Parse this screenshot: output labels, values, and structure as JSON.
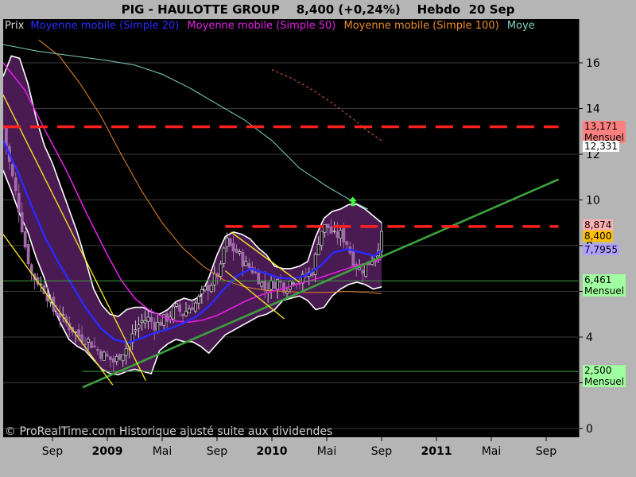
{
  "header": {
    "symbol": "PIG - HAULOTTE GROUP",
    "price": "8,400 (+0,24%)",
    "period": "Hebdo  20 Sep"
  },
  "legend": [
    {
      "label": "Prix",
      "color": "#d8d8d8"
    },
    {
      "label": "Moyenne mobile (Simple 20)",
      "color": "#2a2aff"
    },
    {
      "label": "Moyenne mobile (Simple 50)",
      "color": "#e020e0"
    },
    {
      "label": "Moyenne mobile (Simple 100)",
      "color": "#e8892a"
    },
    {
      "label": "Moye",
      "color": "#7fd0c0"
    }
  ],
  "footer": {
    "watermark": "© ProRealTime.com Historique ajusté suite aux dividendes"
  },
  "colors": {
    "background": "#000000",
    "frame": "#b5b5b5",
    "band_fill": "#4a1a52",
    "candle_up": "#c8c8c8",
    "candle_down": "#a06aa8",
    "resistance": "#ff2020",
    "support_trend": "#3ca03c",
    "channel": "#f0e020"
  },
  "chart_data": {
    "type": "candlestick",
    "title": "PIG - HAULOTTE GROUP",
    "period": "weekly",
    "ylim": [
      0,
      17.3
    ],
    "y_ticks": [
      0,
      2,
      4,
      6,
      8,
      10,
      12,
      14,
      16
    ],
    "x_ticks": [
      {
        "label": "Sep",
        "month": 0
      },
      {
        "label": "2009",
        "month": 4,
        "bold": true
      },
      {
        "label": "Mai",
        "month": 8
      },
      {
        "label": "Sep",
        "month": 12
      },
      {
        "label": "2010",
        "month": 16,
        "bold": true
      },
      {
        "label": "Mai",
        "month": 20
      },
      {
        "label": "Sep",
        "month": 24
      },
      {
        "label": "2011",
        "month": 28,
        "bold": true
      },
      {
        "label": "Mai",
        "month": 32
      },
      {
        "label": "Sep",
        "month": 36
      }
    ],
    "last_month": 24.0,
    "close_anchors": [
      [
        -3.6,
        13.2
      ],
      [
        -3.2,
        11.8
      ],
      [
        -2.5,
        9.8
      ],
      [
        -2.0,
        8.0
      ],
      [
        -1.5,
        6.7
      ],
      [
        -1.0,
        6.4
      ],
      [
        -0.5,
        6.0
      ],
      [
        0,
        5.2
      ],
      [
        0.5,
        5.0
      ],
      [
        1.0,
        4.6
      ],
      [
        1.5,
        4.3
      ],
      [
        2.0,
        4.0
      ],
      [
        2.5,
        3.9
      ],
      [
        3.0,
        3.6
      ],
      [
        3.5,
        3.3
      ],
      [
        4.0,
        3.1
      ],
      [
        4.5,
        2.9
      ],
      [
        5.0,
        3.3
      ],
      [
        5.5,
        3.6
      ],
      [
        6.0,
        4.3
      ],
      [
        6.5,
        4.7
      ],
      [
        7.0,
        4.8
      ],
      [
        7.5,
        4.5
      ],
      [
        8.0,
        4.7
      ],
      [
        8.5,
        4.9
      ],
      [
        9.0,
        5.3
      ],
      [
        9.5,
        5.0
      ],
      [
        10.0,
        5.3
      ],
      [
        10.5,
        5.5
      ],
      [
        11.0,
        6.0
      ],
      [
        11.5,
        6.3
      ],
      [
        12.0,
        6.7
      ],
      [
        12.3,
        7.0
      ],
      [
        12.6,
        8.3
      ],
      [
        13.0,
        7.9
      ],
      [
        13.5,
        7.7
      ],
      [
        14.0,
        7.2
      ],
      [
        14.5,
        7.0
      ],
      [
        15.0,
        6.6
      ],
      [
        15.5,
        6.1
      ],
      [
        16.0,
        6.3
      ],
      [
        16.5,
        6.5
      ],
      [
        17.0,
        6.1
      ],
      [
        17.5,
        6.6
      ],
      [
        18.0,
        6.4
      ],
      [
        18.5,
        6.7
      ],
      [
        19.0,
        6.9
      ],
      [
        19.5,
        8.6
      ],
      [
        20.0,
        8.9
      ],
      [
        20.5,
        8.4
      ],
      [
        21.0,
        8.5
      ],
      [
        21.5,
        8.1
      ],
      [
        22.0,
        7.2
      ],
      [
        22.5,
        6.9
      ],
      [
        23.0,
        7.2
      ],
      [
        23.5,
        7.6
      ],
      [
        24.0,
        8.4
      ]
    ],
    "sma20": [
      [
        -3.6,
        12.6
      ],
      [
        -2.5,
        11.2
      ],
      [
        -1.5,
        9.7
      ],
      [
        -0.5,
        8.3
      ],
      [
        0.5,
        7.2
      ],
      [
        1.5,
        6.2
      ],
      [
        2.5,
        5.2
      ],
      [
        3.5,
        4.4
      ],
      [
        4.5,
        3.9
      ],
      [
        5.5,
        3.75
      ],
      [
        6.5,
        3.95
      ],
      [
        7.5,
        4.2
      ],
      [
        8.5,
        4.35
      ],
      [
        9.5,
        4.6
      ],
      [
        10.5,
        4.9
      ],
      [
        11.5,
        5.4
      ],
      [
        12.5,
        6.1
      ],
      [
        13.5,
        6.7
      ],
      [
        14.5,
        7.0
      ],
      [
        15.5,
        6.8
      ],
      [
        16.5,
        6.6
      ],
      [
        17.5,
        6.55
      ],
      [
        18.5,
        6.7
      ],
      [
        19.5,
        7.1
      ],
      [
        20.5,
        7.7
      ],
      [
        21.5,
        7.85
      ],
      [
        22.5,
        7.7
      ],
      [
        23.5,
        7.55
      ],
      [
        24.0,
        7.8
      ]
    ],
    "sma50": [
      [
        -3.6,
        16.0
      ],
      [
        -2.0,
        14.8
      ],
      [
        -0.5,
        13.0
      ],
      [
        1.0,
        11.3
      ],
      [
        2.5,
        9.4
      ],
      [
        4.0,
        7.6
      ],
      [
        5.0,
        6.5
      ],
      [
        6.0,
        5.7
      ],
      [
        7.0,
        5.2
      ],
      [
        8.0,
        4.9
      ],
      [
        9.0,
        4.7
      ],
      [
        10.0,
        4.65
      ],
      [
        11.0,
        4.75
      ],
      [
        12.0,
        4.95
      ],
      [
        13.0,
        5.25
      ],
      [
        14.0,
        5.55
      ],
      [
        15.0,
        5.8
      ],
      [
        16.0,
        6.0
      ],
      [
        17.0,
        6.15
      ],
      [
        18.0,
        6.35
      ],
      [
        19.0,
        6.5
      ],
      [
        20.0,
        6.7
      ],
      [
        21.0,
        6.9
      ],
      [
        22.0,
        7.1
      ],
      [
        23.0,
        7.25
      ],
      [
        24.0,
        7.4
      ]
    ],
    "sma100": [
      [
        -1.0,
        17.0
      ],
      [
        0.5,
        16.3
      ],
      [
        2.0,
        15.1
      ],
      [
        3.5,
        13.7
      ],
      [
        5.0,
        12.0
      ],
      [
        6.5,
        10.4
      ],
      [
        8.0,
        9.0
      ],
      [
        9.5,
        7.9
      ],
      [
        11.0,
        7.1
      ],
      [
        12.5,
        6.5
      ],
      [
        14.0,
        6.2
      ],
      [
        15.5,
        6.05
      ],
      [
        17.0,
        6.0
      ],
      [
        18.5,
        5.95
      ],
      [
        20.0,
        5.95
      ],
      [
        21.5,
        6.0
      ],
      [
        23.0,
        5.95
      ],
      [
        24.0,
        5.9
      ]
    ],
    "sma_cyan": [
      [
        -3.6,
        16.8
      ],
      [
        -1.0,
        16.5
      ],
      [
        1.5,
        16.3
      ],
      [
        4.0,
        16.1
      ],
      [
        6.0,
        15.9
      ],
      [
        8.0,
        15.5
      ],
      [
        10.0,
        14.9
      ],
      [
        12.0,
        14.2
      ],
      [
        14.0,
        13.5
      ],
      [
        16.0,
        12.6
      ],
      [
        18.0,
        11.4
      ],
      [
        20.0,
        10.6
      ],
      [
        22.0,
        9.9
      ],
      [
        23.0,
        9.6
      ]
    ],
    "sma_dotted": [
      [
        16.0,
        15.7
      ],
      [
        17.5,
        15.3
      ],
      [
        19.0,
        14.8
      ],
      [
        20.5,
        14.2
      ],
      [
        22.0,
        13.5
      ],
      [
        23.0,
        13.0
      ],
      [
        24.0,
        12.6
      ]
    ],
    "band_upper": [
      [
        -3.6,
        15.4
      ],
      [
        -3.0,
        16.3
      ],
      [
        -2.4,
        16.2
      ],
      [
        -1.8,
        15.1
      ],
      [
        -1.2,
        13.6
      ],
      [
        -0.6,
        12.4
      ],
      [
        0,
        11.6
      ],
      [
        0.6,
        10.6
      ],
      [
        1.2,
        9.6
      ],
      [
        1.8,
        8.6
      ],
      [
        2.4,
        7.4
      ],
      [
        3.0,
        6.1
      ],
      [
        3.6,
        5.4
      ],
      [
        4.2,
        5.0
      ],
      [
        4.8,
        4.9
      ],
      [
        5.4,
        5.2
      ],
      [
        6.0,
        5.3
      ],
      [
        6.6,
        5.3
      ],
      [
        7.2,
        5.1
      ],
      [
        7.8,
        5.0
      ],
      [
        8.4,
        5.2
      ],
      [
        9.0,
        5.55
      ],
      [
        9.6,
        5.7
      ],
      [
        10.2,
        5.6
      ],
      [
        10.8,
        5.8
      ],
      [
        11.4,
        6.6
      ],
      [
        12.0,
        7.6
      ],
      [
        12.6,
        8.4
      ],
      [
        13.2,
        8.6
      ],
      [
        13.8,
        8.5
      ],
      [
        14.4,
        8.3
      ],
      [
        15.0,
        7.9
      ],
      [
        15.6,
        7.6
      ],
      [
        16.2,
        7.1
      ],
      [
        16.8,
        7.0
      ],
      [
        17.4,
        7.0
      ],
      [
        18.0,
        7.1
      ],
      [
        18.6,
        7.3
      ],
      [
        19.2,
        8.4
      ],
      [
        19.8,
        9.2
      ],
      [
        20.4,
        9.5
      ],
      [
        21.0,
        9.6
      ],
      [
        21.6,
        9.8
      ],
      [
        22.2,
        9.8
      ],
      [
        22.8,
        9.6
      ],
      [
        23.4,
        9.3
      ],
      [
        24.0,
        9.0
      ]
    ],
    "band_lower": [
      [
        24.0,
        6.2
      ],
      [
        23.4,
        6.1
      ],
      [
        22.8,
        6.3
      ],
      [
        22.2,
        6.4
      ],
      [
        21.6,
        6.3
      ],
      [
        21.0,
        6.1
      ],
      [
        20.4,
        5.8
      ],
      [
        19.8,
        5.3
      ],
      [
        19.2,
        5.2
      ],
      [
        18.6,
        5.6
      ],
      [
        18.0,
        5.8
      ],
      [
        17.4,
        5.7
      ],
      [
        16.8,
        5.6
      ],
      [
        16.2,
        5.2
      ],
      [
        15.6,
        5.0
      ],
      [
        15.0,
        4.9
      ],
      [
        14.4,
        4.7
      ],
      [
        13.8,
        4.5
      ],
      [
        13.2,
        4.3
      ],
      [
        12.6,
        4.1
      ],
      [
        12.0,
        3.7
      ],
      [
        11.4,
        3.3
      ],
      [
        10.8,
        3.6
      ],
      [
        10.2,
        3.8
      ],
      [
        9.6,
        3.8
      ],
      [
        9.0,
        3.9
      ],
      [
        8.4,
        3.7
      ],
      [
        7.8,
        3.4
      ],
      [
        7.2,
        2.4
      ],
      [
        6.6,
        2.5
      ],
      [
        6.0,
        2.6
      ],
      [
        5.4,
        2.5
      ],
      [
        4.8,
        2.35
      ],
      [
        4.2,
        2.4
      ],
      [
        3.6,
        2.6
      ],
      [
        3.0,
        3.0
      ],
      [
        2.4,
        3.4
      ],
      [
        1.8,
        3.6
      ],
      [
        1.2,
        3.9
      ],
      [
        0.6,
        4.6
      ],
      [
        0,
        5.4
      ],
      [
        -0.6,
        6.6
      ],
      [
        -1.2,
        7.5
      ],
      [
        -1.8,
        8.6
      ],
      [
        -2.4,
        9.4
      ],
      [
        -3.0,
        10.4
      ],
      [
        -3.6,
        11.3
      ]
    ],
    "resistances": [
      {
        "y": 13.2,
        "x_from": -3.6,
        "x_to": 36.9
      },
      {
        "y": 8.84,
        "x_from": 12.6,
        "x_to": 36.9
      }
    ],
    "support_lines": [
      {
        "y": 6.461,
        "color": "#3ca03c"
      },
      {
        "y": 2.5,
        "color": "#3ca03c",
        "x_from": 2.2
      }
    ],
    "trend_lines": [
      {
        "from": [
          2.2,
          1.8
        ],
        "to": [
          36.9,
          10.9
        ],
        "color": "#3ca03c"
      },
      {
        "from": [
          -3.6,
          14.6
        ],
        "to": [
          6.8,
          2.1
        ],
        "color": "#f0e020"
      },
      {
        "from": [
          -3.6,
          8.5
        ],
        "to": [
          4.4,
          1.9
        ],
        "color": "#f0e020"
      },
      {
        "from": [
          13.0,
          8.6
        ],
        "to": [
          18.0,
          6.4
        ],
        "color": "#f0e020"
      },
      {
        "from": [
          12.6,
          6.9
        ],
        "to": [
          16.9,
          4.8
        ],
        "color": "#f0e020"
      }
    ],
    "signal_arrow": {
      "x": 21.9,
      "y": 9.9
    },
    "price_tags": [
      {
        "value": "13,171",
        "sub": "Mensuel",
        "y": 13.17,
        "bg": "#ff8080",
        "fg": "#000000"
      },
      {
        "value": "12,331",
        "sub": "",
        "y": 12.3,
        "bg": "#ffffff",
        "fg": "#000000"
      },
      {
        "value": "8,874",
        "sub": "",
        "y": 8.87,
        "bg": "#ffb0b0",
        "fg": "#000000"
      },
      {
        "value": "8,400",
        "sub": "",
        "y": 8.4,
        "bg": "#ffc000",
        "fg": "#000000"
      },
      {
        "value": "7,7955",
        "sub": "",
        "y": 7.8,
        "bg": "#b0a0ff",
        "fg": "#000000"
      },
      {
        "value": "6,461",
        "sub": "Mensuel",
        "y": 6.461,
        "bg": "#a0ffa0",
        "fg": "#000000"
      },
      {
        "value": "2,500",
        "sub": "Mensuel",
        "y": 2.5,
        "bg": "#a0ffa0",
        "fg": "#000000"
      }
    ]
  }
}
